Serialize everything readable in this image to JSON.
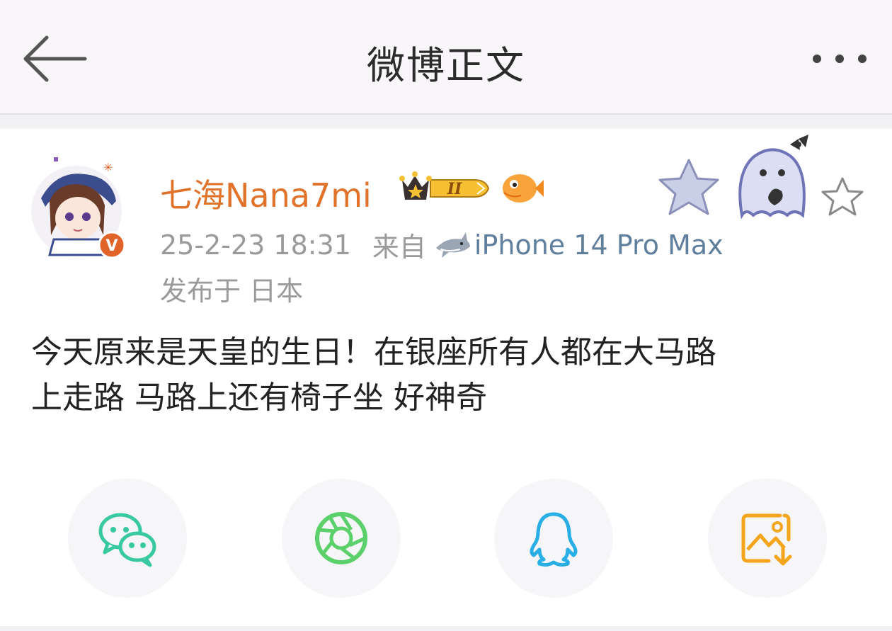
{
  "header": {
    "title": "微博正文",
    "back_icon": "back-arrow-icon",
    "more_icon": "more-dots-icon"
  },
  "post": {
    "author": {
      "name": "七海Nana7mi",
      "verified_badge": "V",
      "member_level": "II"
    },
    "time": "25-2-23 18:31",
    "source_label": "来自",
    "device": "iPhone 14 Pro Max",
    "location": "发布于 日本",
    "content_lines": [
      "今天原来是天皇的生日！在银座所有人都在大马路",
      "上走路 马路上还有椅子坐 好神奇"
    ]
  },
  "share_buttons": [
    {
      "name": "wechat",
      "icon": "wechat-icon",
      "color": "#38c9a0"
    },
    {
      "name": "moments",
      "icon": "moments-icon",
      "color": "#5bd06b"
    },
    {
      "name": "qq",
      "icon": "qq-icon",
      "color": "#29aee6"
    },
    {
      "name": "save-image",
      "icon": "save-image-icon",
      "color": "#f3a51c"
    }
  ],
  "colors": {
    "username": "#e0722a",
    "meta": "#9a9a9a",
    "device": "#5f7f9c",
    "header_bg": "#f8f6f8",
    "verified": "#e0632a"
  }
}
